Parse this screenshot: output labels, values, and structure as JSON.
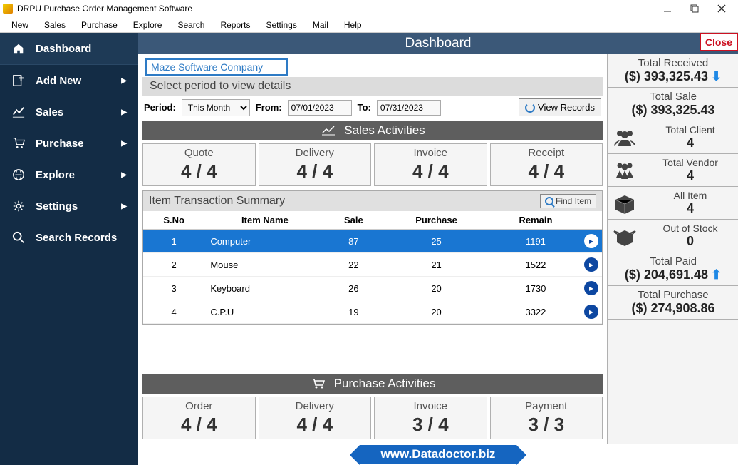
{
  "window": {
    "title": "DRPU Purchase Order Management Software"
  },
  "menubar": [
    "New",
    "Sales",
    "Purchase",
    "Explore",
    "Search",
    "Reports",
    "Settings",
    "Mail",
    "Help"
  ],
  "sidebar": [
    {
      "label": "Dashboard",
      "active": true,
      "chevron": false
    },
    {
      "label": "Add New",
      "chevron": true
    },
    {
      "label": "Sales",
      "chevron": true
    },
    {
      "label": "Purchase",
      "chevron": true
    },
    {
      "label": "Explore",
      "chevron": true
    },
    {
      "label": "Settings",
      "chevron": true
    },
    {
      "label": "Search Records",
      "chevron": false
    }
  ],
  "dashboard": {
    "title": "Dashboard",
    "close": "Close",
    "company": "Maze Software Company",
    "prompt": "Select period to view details",
    "period_label": "Period:",
    "period_value": "This Month",
    "from_label": "From:",
    "from_value": "07/01/2023",
    "to_label": "To:",
    "to_value": "07/31/2023",
    "view_records": "View Records"
  },
  "sales_activities": {
    "title": "Sales Activities",
    "cards": [
      {
        "label": "Quote",
        "val": "4 / 4"
      },
      {
        "label": "Delivery",
        "val": "4 / 4"
      },
      {
        "label": "Invoice",
        "val": "4 / 4"
      },
      {
        "label": "Receipt",
        "val": "4 / 4"
      }
    ]
  },
  "item_table": {
    "title": "Item Transaction Summary",
    "find": "Find Item",
    "headers": [
      "S.No",
      "Item Name",
      "Sale",
      "Purchase",
      "Remain"
    ],
    "rows": [
      {
        "sno": "1",
        "name": "Computer",
        "sale": "87",
        "purchase": "25",
        "remain": "1191",
        "selected": true
      },
      {
        "sno": "2",
        "name": "Mouse",
        "sale": "22",
        "purchase": "21",
        "remain": "1522"
      },
      {
        "sno": "3",
        "name": "Keyboard",
        "sale": "26",
        "purchase": "20",
        "remain": "1730"
      },
      {
        "sno": "4",
        "name": "C.P.U",
        "sale": "19",
        "purchase": "20",
        "remain": "3322"
      }
    ]
  },
  "purchase_activities": {
    "title": "Purchase Activities",
    "cards": [
      {
        "label": "Order",
        "val": "4 / 4"
      },
      {
        "label": "Delivery",
        "val": "4 / 4"
      },
      {
        "label": "Invoice",
        "val": "3 / 4"
      },
      {
        "label": "Payment",
        "val": "3 / 3"
      }
    ]
  },
  "right": [
    {
      "type": "money",
      "lbl": "Total Received",
      "val": "($) 393,325.43",
      "arrow": "down"
    },
    {
      "type": "money",
      "lbl": "Total Sale",
      "val": "($) 393,325.43"
    },
    {
      "type": "icon",
      "lbl": "Total Client",
      "val": "4",
      "icon": "users"
    },
    {
      "type": "icon",
      "lbl": "Total Vendor",
      "val": "4",
      "icon": "vendor"
    },
    {
      "type": "icon",
      "lbl": "All Item",
      "val": "4",
      "icon": "box"
    },
    {
      "type": "icon",
      "lbl": "Out of Stock",
      "val": "0",
      "icon": "box-open"
    },
    {
      "type": "money",
      "lbl": "Total Paid",
      "val": "($) 204,691.48",
      "arrow": "up"
    },
    {
      "type": "money",
      "lbl": "Total Purchase",
      "val": "($) 274,908.86"
    }
  ],
  "footer": "www.Datadoctor.biz"
}
